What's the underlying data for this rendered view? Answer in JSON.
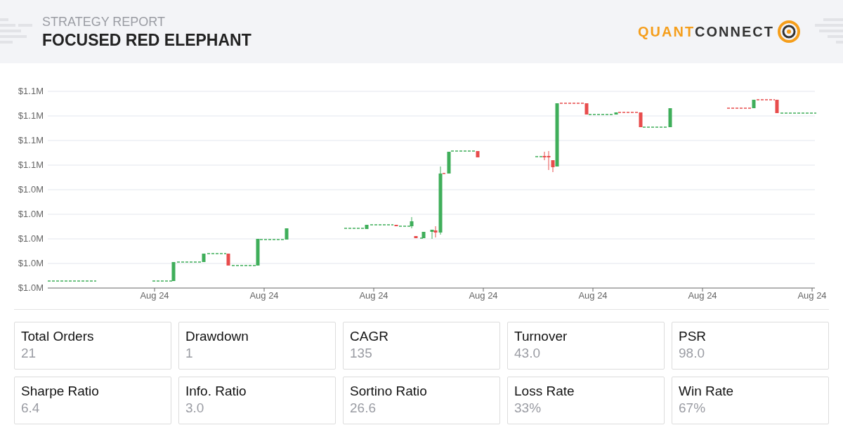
{
  "header": {
    "subtitle": "STRATEGY REPORT",
    "title": "FOCUSED RED ELEPHANT",
    "logo": {
      "part_1": "QUANT",
      "part_2": "CONNECT"
    }
  },
  "chart": {
    "y_tick_labels": [
      "$1.1M",
      "$1.1M",
      "$1.1M",
      "$1.1M",
      "$1.0M",
      "$1.0M",
      "$1.0M",
      "$1.0M",
      "$1.0M"
    ],
    "x_tick_labels": [
      "Aug 24",
      "Aug 24",
      "Aug 24",
      "Aug 24",
      "Aug 24",
      "Aug 24",
      "Aug 24"
    ]
  },
  "stats": [
    {
      "label": "Total Orders",
      "value": "21"
    },
    {
      "label": "Drawdown",
      "value": "1"
    },
    {
      "label": "CAGR",
      "value": "135"
    },
    {
      "label": "Turnover",
      "value": "43.0"
    },
    {
      "label": "PSR",
      "value": "98.0"
    },
    {
      "label": "Sharpe Ratio",
      "value": "6.4"
    },
    {
      "label": "Info. Ratio",
      "value": "3.0"
    },
    {
      "label": "Sortino Ratio",
      "value": "26.6"
    },
    {
      "label": "Loss Rate",
      "value": "33%"
    },
    {
      "label": "Win Rate",
      "value": "67%"
    }
  ]
}
